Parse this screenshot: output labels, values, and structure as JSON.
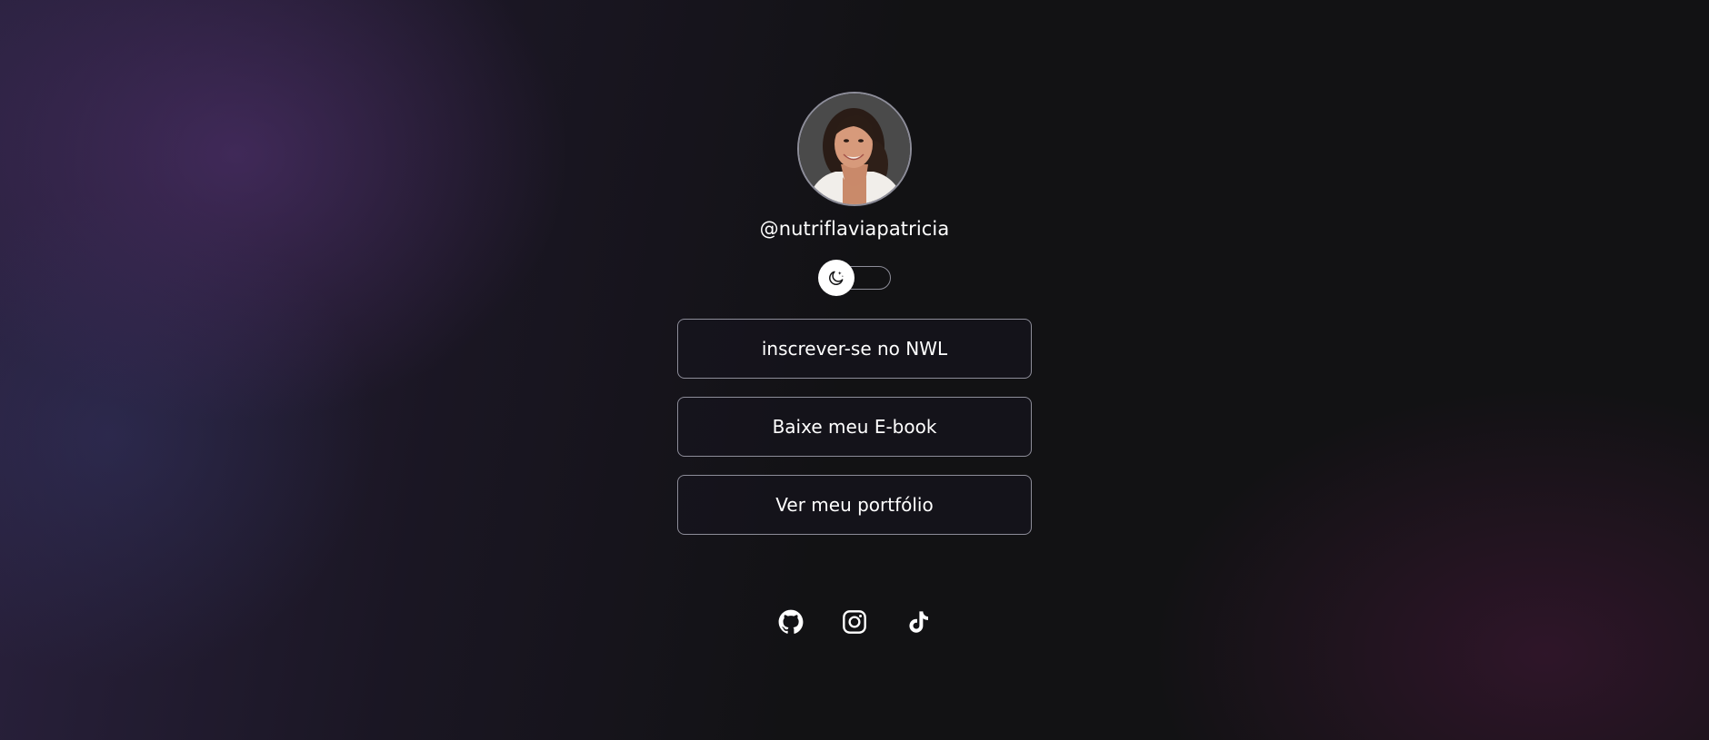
{
  "profile": {
    "handle": "@nutriflaviapatricia",
    "avatar_alt": "avatar"
  },
  "theme_switch": {
    "icon": "moon-stars-icon",
    "state": "dark"
  },
  "links": [
    {
      "label": "inscrever-se no NWL"
    },
    {
      "label": "Baixe meu E-book"
    },
    {
      "label": "Ver meu portfólio"
    }
  ],
  "social": [
    {
      "icon": "github-icon"
    },
    {
      "icon": "instagram-icon"
    },
    {
      "icon": "tiktok-icon"
    }
  ],
  "colors": {
    "background": "#121214",
    "accent_purple": "#3a2a55",
    "border": "#8d8d99",
    "text": "#ffffff"
  }
}
